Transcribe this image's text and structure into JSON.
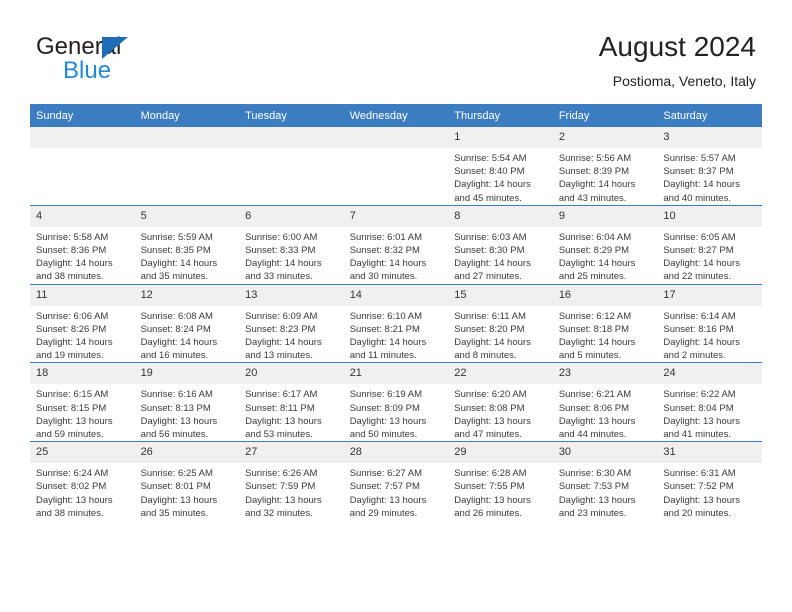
{
  "brand": {
    "name_part1": "General",
    "name_part2": "Blue",
    "triangle_color": "#1d6cb5",
    "blue_color": "#2389d6"
  },
  "header": {
    "title": "August 2024",
    "subtitle": "Postioma, Veneto, Italy",
    "header_bg": "#3b7dc0",
    "daynum_bg": "#f0f0f0"
  },
  "weekday_headers": [
    "Sunday",
    "Monday",
    "Tuesday",
    "Wednesday",
    "Thursday",
    "Friday",
    "Saturday"
  ],
  "labels": {
    "sunrise_prefix": "Sunrise:",
    "sunset_prefix": "Sunset:",
    "daylight_prefix": "Daylight:"
  },
  "weeks": [
    [
      {
        "day": "",
        "sunrise": "",
        "sunset": "",
        "daylight_line1": "",
        "daylight_line2": "",
        "empty": true
      },
      {
        "day": "",
        "sunrise": "",
        "sunset": "",
        "daylight_line1": "",
        "daylight_line2": "",
        "empty": true
      },
      {
        "day": "",
        "sunrise": "",
        "sunset": "",
        "daylight_line1": "",
        "daylight_line2": "",
        "empty": true
      },
      {
        "day": "",
        "sunrise": "",
        "sunset": "",
        "daylight_line1": "",
        "daylight_line2": "",
        "empty": true
      },
      {
        "day": "1",
        "sunrise": "Sunrise: 5:54 AM",
        "sunset": "Sunset: 8:40 PM",
        "daylight_line1": "Daylight: 14 hours",
        "daylight_line2": "and 45 minutes.",
        "empty": false
      },
      {
        "day": "2",
        "sunrise": "Sunrise: 5:56 AM",
        "sunset": "Sunset: 8:39 PM",
        "daylight_line1": "Daylight: 14 hours",
        "daylight_line2": "and 43 minutes.",
        "empty": false
      },
      {
        "day": "3",
        "sunrise": "Sunrise: 5:57 AM",
        "sunset": "Sunset: 8:37 PM",
        "daylight_line1": "Daylight: 14 hours",
        "daylight_line2": "and 40 minutes.",
        "empty": false
      }
    ],
    [
      {
        "day": "4",
        "sunrise": "Sunrise: 5:58 AM",
        "sunset": "Sunset: 8:36 PM",
        "daylight_line1": "Daylight: 14 hours",
        "daylight_line2": "and 38 minutes.",
        "empty": false
      },
      {
        "day": "5",
        "sunrise": "Sunrise: 5:59 AM",
        "sunset": "Sunset: 8:35 PM",
        "daylight_line1": "Daylight: 14 hours",
        "daylight_line2": "and 35 minutes.",
        "empty": false
      },
      {
        "day": "6",
        "sunrise": "Sunrise: 6:00 AM",
        "sunset": "Sunset: 8:33 PM",
        "daylight_line1": "Daylight: 14 hours",
        "daylight_line2": "and 33 minutes.",
        "empty": false
      },
      {
        "day": "7",
        "sunrise": "Sunrise: 6:01 AM",
        "sunset": "Sunset: 8:32 PM",
        "daylight_line1": "Daylight: 14 hours",
        "daylight_line2": "and 30 minutes.",
        "empty": false
      },
      {
        "day": "8",
        "sunrise": "Sunrise: 6:03 AM",
        "sunset": "Sunset: 8:30 PM",
        "daylight_line1": "Daylight: 14 hours",
        "daylight_line2": "and 27 minutes.",
        "empty": false
      },
      {
        "day": "9",
        "sunrise": "Sunrise: 6:04 AM",
        "sunset": "Sunset: 8:29 PM",
        "daylight_line1": "Daylight: 14 hours",
        "daylight_line2": "and 25 minutes.",
        "empty": false
      },
      {
        "day": "10",
        "sunrise": "Sunrise: 6:05 AM",
        "sunset": "Sunset: 8:27 PM",
        "daylight_line1": "Daylight: 14 hours",
        "daylight_line2": "and 22 minutes.",
        "empty": false
      }
    ],
    [
      {
        "day": "11",
        "sunrise": "Sunrise: 6:06 AM",
        "sunset": "Sunset: 8:26 PM",
        "daylight_line1": "Daylight: 14 hours",
        "daylight_line2": "and 19 minutes.",
        "empty": false
      },
      {
        "day": "12",
        "sunrise": "Sunrise: 6:08 AM",
        "sunset": "Sunset: 8:24 PM",
        "daylight_line1": "Daylight: 14 hours",
        "daylight_line2": "and 16 minutes.",
        "empty": false
      },
      {
        "day": "13",
        "sunrise": "Sunrise: 6:09 AM",
        "sunset": "Sunset: 8:23 PM",
        "daylight_line1": "Daylight: 14 hours",
        "daylight_line2": "and 13 minutes.",
        "empty": false
      },
      {
        "day": "14",
        "sunrise": "Sunrise: 6:10 AM",
        "sunset": "Sunset: 8:21 PM",
        "daylight_line1": "Daylight: 14 hours",
        "daylight_line2": "and 11 minutes.",
        "empty": false
      },
      {
        "day": "15",
        "sunrise": "Sunrise: 6:11 AM",
        "sunset": "Sunset: 8:20 PM",
        "daylight_line1": "Daylight: 14 hours",
        "daylight_line2": "and 8 minutes.",
        "empty": false
      },
      {
        "day": "16",
        "sunrise": "Sunrise: 6:12 AM",
        "sunset": "Sunset: 8:18 PM",
        "daylight_line1": "Daylight: 14 hours",
        "daylight_line2": "and 5 minutes.",
        "empty": false
      },
      {
        "day": "17",
        "sunrise": "Sunrise: 6:14 AM",
        "sunset": "Sunset: 8:16 PM",
        "daylight_line1": "Daylight: 14 hours",
        "daylight_line2": "and 2 minutes.",
        "empty": false
      }
    ],
    [
      {
        "day": "18",
        "sunrise": "Sunrise: 6:15 AM",
        "sunset": "Sunset: 8:15 PM",
        "daylight_line1": "Daylight: 13 hours",
        "daylight_line2": "and 59 minutes.",
        "empty": false
      },
      {
        "day": "19",
        "sunrise": "Sunrise: 6:16 AM",
        "sunset": "Sunset: 8:13 PM",
        "daylight_line1": "Daylight: 13 hours",
        "daylight_line2": "and 56 minutes.",
        "empty": false
      },
      {
        "day": "20",
        "sunrise": "Sunrise: 6:17 AM",
        "sunset": "Sunset: 8:11 PM",
        "daylight_line1": "Daylight: 13 hours",
        "daylight_line2": "and 53 minutes.",
        "empty": false
      },
      {
        "day": "21",
        "sunrise": "Sunrise: 6:19 AM",
        "sunset": "Sunset: 8:09 PM",
        "daylight_line1": "Daylight: 13 hours",
        "daylight_line2": "and 50 minutes.",
        "empty": false
      },
      {
        "day": "22",
        "sunrise": "Sunrise: 6:20 AM",
        "sunset": "Sunset: 8:08 PM",
        "daylight_line1": "Daylight: 13 hours",
        "daylight_line2": "and 47 minutes.",
        "empty": false
      },
      {
        "day": "23",
        "sunrise": "Sunrise: 6:21 AM",
        "sunset": "Sunset: 8:06 PM",
        "daylight_line1": "Daylight: 13 hours",
        "daylight_line2": "and 44 minutes.",
        "empty": false
      },
      {
        "day": "24",
        "sunrise": "Sunrise: 6:22 AM",
        "sunset": "Sunset: 8:04 PM",
        "daylight_line1": "Daylight: 13 hours",
        "daylight_line2": "and 41 minutes.",
        "empty": false
      }
    ],
    [
      {
        "day": "25",
        "sunrise": "Sunrise: 6:24 AM",
        "sunset": "Sunset: 8:02 PM",
        "daylight_line1": "Daylight: 13 hours",
        "daylight_line2": "and 38 minutes.",
        "empty": false
      },
      {
        "day": "26",
        "sunrise": "Sunrise: 6:25 AM",
        "sunset": "Sunset: 8:01 PM",
        "daylight_line1": "Daylight: 13 hours",
        "daylight_line2": "and 35 minutes.",
        "empty": false
      },
      {
        "day": "27",
        "sunrise": "Sunrise: 6:26 AM",
        "sunset": "Sunset: 7:59 PM",
        "daylight_line1": "Daylight: 13 hours",
        "daylight_line2": "and 32 minutes.",
        "empty": false
      },
      {
        "day": "28",
        "sunrise": "Sunrise: 6:27 AM",
        "sunset": "Sunset: 7:57 PM",
        "daylight_line1": "Daylight: 13 hours",
        "daylight_line2": "and 29 minutes.",
        "empty": false
      },
      {
        "day": "29",
        "sunrise": "Sunrise: 6:28 AM",
        "sunset": "Sunset: 7:55 PM",
        "daylight_line1": "Daylight: 13 hours",
        "daylight_line2": "and 26 minutes.",
        "empty": false
      },
      {
        "day": "30",
        "sunrise": "Sunrise: 6:30 AM",
        "sunset": "Sunset: 7:53 PM",
        "daylight_line1": "Daylight: 13 hours",
        "daylight_line2": "and 23 minutes.",
        "empty": false
      },
      {
        "day": "31",
        "sunrise": "Sunrise: 6:31 AM",
        "sunset": "Sunset: 7:52 PM",
        "daylight_line1": "Daylight: 13 hours",
        "daylight_line2": "and 20 minutes.",
        "empty": false
      }
    ]
  ]
}
